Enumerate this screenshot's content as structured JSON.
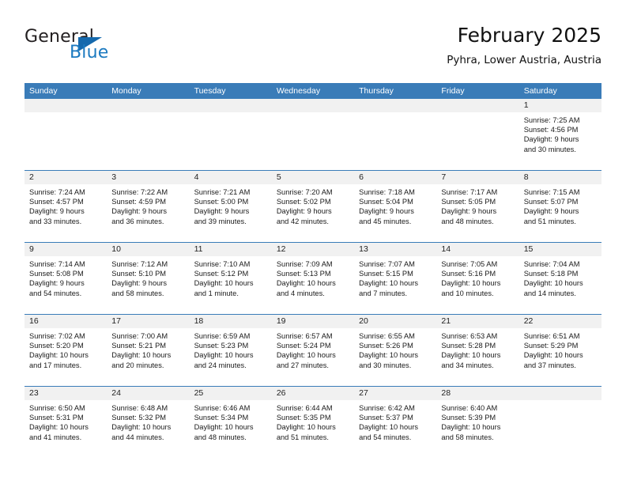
{
  "brand": {
    "name_part1": "General",
    "name_part2": "Blue",
    "accent_color": "#1c7ac0",
    "triangle_color": "#1569ad"
  },
  "header": {
    "title": "February 2025",
    "subtitle": "Pyhra, Lower Austria, Austria"
  },
  "calendar": {
    "header_bg": "#3a7cb8",
    "daynum_band_bg": "#f1f1f1",
    "weekdays": [
      "Sunday",
      "Monday",
      "Tuesday",
      "Wednesday",
      "Thursday",
      "Friday",
      "Saturday"
    ],
    "weeks": [
      [
        {
          "day": "",
          "empty": true
        },
        {
          "day": "",
          "empty": true
        },
        {
          "day": "",
          "empty": true
        },
        {
          "day": "",
          "empty": true
        },
        {
          "day": "",
          "empty": true
        },
        {
          "day": "",
          "empty": true
        },
        {
          "day": "1",
          "sunrise": "Sunrise: 7:25 AM",
          "sunset": "Sunset: 4:56 PM",
          "daylight1": "Daylight: 9 hours",
          "daylight2": "and 30 minutes."
        }
      ],
      [
        {
          "day": "2",
          "sunrise": "Sunrise: 7:24 AM",
          "sunset": "Sunset: 4:57 PM",
          "daylight1": "Daylight: 9 hours",
          "daylight2": "and 33 minutes."
        },
        {
          "day": "3",
          "sunrise": "Sunrise: 7:22 AM",
          "sunset": "Sunset: 4:59 PM",
          "daylight1": "Daylight: 9 hours",
          "daylight2": "and 36 minutes."
        },
        {
          "day": "4",
          "sunrise": "Sunrise: 7:21 AM",
          "sunset": "Sunset: 5:00 PM",
          "daylight1": "Daylight: 9 hours",
          "daylight2": "and 39 minutes."
        },
        {
          "day": "5",
          "sunrise": "Sunrise: 7:20 AM",
          "sunset": "Sunset: 5:02 PM",
          "daylight1": "Daylight: 9 hours",
          "daylight2": "and 42 minutes."
        },
        {
          "day": "6",
          "sunrise": "Sunrise: 7:18 AM",
          "sunset": "Sunset: 5:04 PM",
          "daylight1": "Daylight: 9 hours",
          "daylight2": "and 45 minutes."
        },
        {
          "day": "7",
          "sunrise": "Sunrise: 7:17 AM",
          "sunset": "Sunset: 5:05 PM",
          "daylight1": "Daylight: 9 hours",
          "daylight2": "and 48 minutes."
        },
        {
          "day": "8",
          "sunrise": "Sunrise: 7:15 AM",
          "sunset": "Sunset: 5:07 PM",
          "daylight1": "Daylight: 9 hours",
          "daylight2": "and 51 minutes."
        }
      ],
      [
        {
          "day": "9",
          "sunrise": "Sunrise: 7:14 AM",
          "sunset": "Sunset: 5:08 PM",
          "daylight1": "Daylight: 9 hours",
          "daylight2": "and 54 minutes."
        },
        {
          "day": "10",
          "sunrise": "Sunrise: 7:12 AM",
          "sunset": "Sunset: 5:10 PM",
          "daylight1": "Daylight: 9 hours",
          "daylight2": "and 58 minutes."
        },
        {
          "day": "11",
          "sunrise": "Sunrise: 7:10 AM",
          "sunset": "Sunset: 5:12 PM",
          "daylight1": "Daylight: 10 hours",
          "daylight2": "and 1 minute."
        },
        {
          "day": "12",
          "sunrise": "Sunrise: 7:09 AM",
          "sunset": "Sunset: 5:13 PM",
          "daylight1": "Daylight: 10 hours",
          "daylight2": "and 4 minutes."
        },
        {
          "day": "13",
          "sunrise": "Sunrise: 7:07 AM",
          "sunset": "Sunset: 5:15 PM",
          "daylight1": "Daylight: 10 hours",
          "daylight2": "and 7 minutes."
        },
        {
          "day": "14",
          "sunrise": "Sunrise: 7:05 AM",
          "sunset": "Sunset: 5:16 PM",
          "daylight1": "Daylight: 10 hours",
          "daylight2": "and 10 minutes."
        },
        {
          "day": "15",
          "sunrise": "Sunrise: 7:04 AM",
          "sunset": "Sunset: 5:18 PM",
          "daylight1": "Daylight: 10 hours",
          "daylight2": "and 14 minutes."
        }
      ],
      [
        {
          "day": "16",
          "sunrise": "Sunrise: 7:02 AM",
          "sunset": "Sunset: 5:20 PM",
          "daylight1": "Daylight: 10 hours",
          "daylight2": "and 17 minutes."
        },
        {
          "day": "17",
          "sunrise": "Sunrise: 7:00 AM",
          "sunset": "Sunset: 5:21 PM",
          "daylight1": "Daylight: 10 hours",
          "daylight2": "and 20 minutes."
        },
        {
          "day": "18",
          "sunrise": "Sunrise: 6:59 AM",
          "sunset": "Sunset: 5:23 PM",
          "daylight1": "Daylight: 10 hours",
          "daylight2": "and 24 minutes."
        },
        {
          "day": "19",
          "sunrise": "Sunrise: 6:57 AM",
          "sunset": "Sunset: 5:24 PM",
          "daylight1": "Daylight: 10 hours",
          "daylight2": "and 27 minutes."
        },
        {
          "day": "20",
          "sunrise": "Sunrise: 6:55 AM",
          "sunset": "Sunset: 5:26 PM",
          "daylight1": "Daylight: 10 hours",
          "daylight2": "and 30 minutes."
        },
        {
          "day": "21",
          "sunrise": "Sunrise: 6:53 AM",
          "sunset": "Sunset: 5:28 PM",
          "daylight1": "Daylight: 10 hours",
          "daylight2": "and 34 minutes."
        },
        {
          "day": "22",
          "sunrise": "Sunrise: 6:51 AM",
          "sunset": "Sunset: 5:29 PM",
          "daylight1": "Daylight: 10 hours",
          "daylight2": "and 37 minutes."
        }
      ],
      [
        {
          "day": "23",
          "sunrise": "Sunrise: 6:50 AM",
          "sunset": "Sunset: 5:31 PM",
          "daylight1": "Daylight: 10 hours",
          "daylight2": "and 41 minutes."
        },
        {
          "day": "24",
          "sunrise": "Sunrise: 6:48 AM",
          "sunset": "Sunset: 5:32 PM",
          "daylight1": "Daylight: 10 hours",
          "daylight2": "and 44 minutes."
        },
        {
          "day": "25",
          "sunrise": "Sunrise: 6:46 AM",
          "sunset": "Sunset: 5:34 PM",
          "daylight1": "Daylight: 10 hours",
          "daylight2": "and 48 minutes."
        },
        {
          "day": "26",
          "sunrise": "Sunrise: 6:44 AM",
          "sunset": "Sunset: 5:35 PM",
          "daylight1": "Daylight: 10 hours",
          "daylight2": "and 51 minutes."
        },
        {
          "day": "27",
          "sunrise": "Sunrise: 6:42 AM",
          "sunset": "Sunset: 5:37 PM",
          "daylight1": "Daylight: 10 hours",
          "daylight2": "and 54 minutes."
        },
        {
          "day": "28",
          "sunrise": "Sunrise: 6:40 AM",
          "sunset": "Sunset: 5:39 PM",
          "daylight1": "Daylight: 10 hours",
          "daylight2": "and 58 minutes."
        },
        {
          "day": "",
          "empty": true
        }
      ]
    ]
  }
}
